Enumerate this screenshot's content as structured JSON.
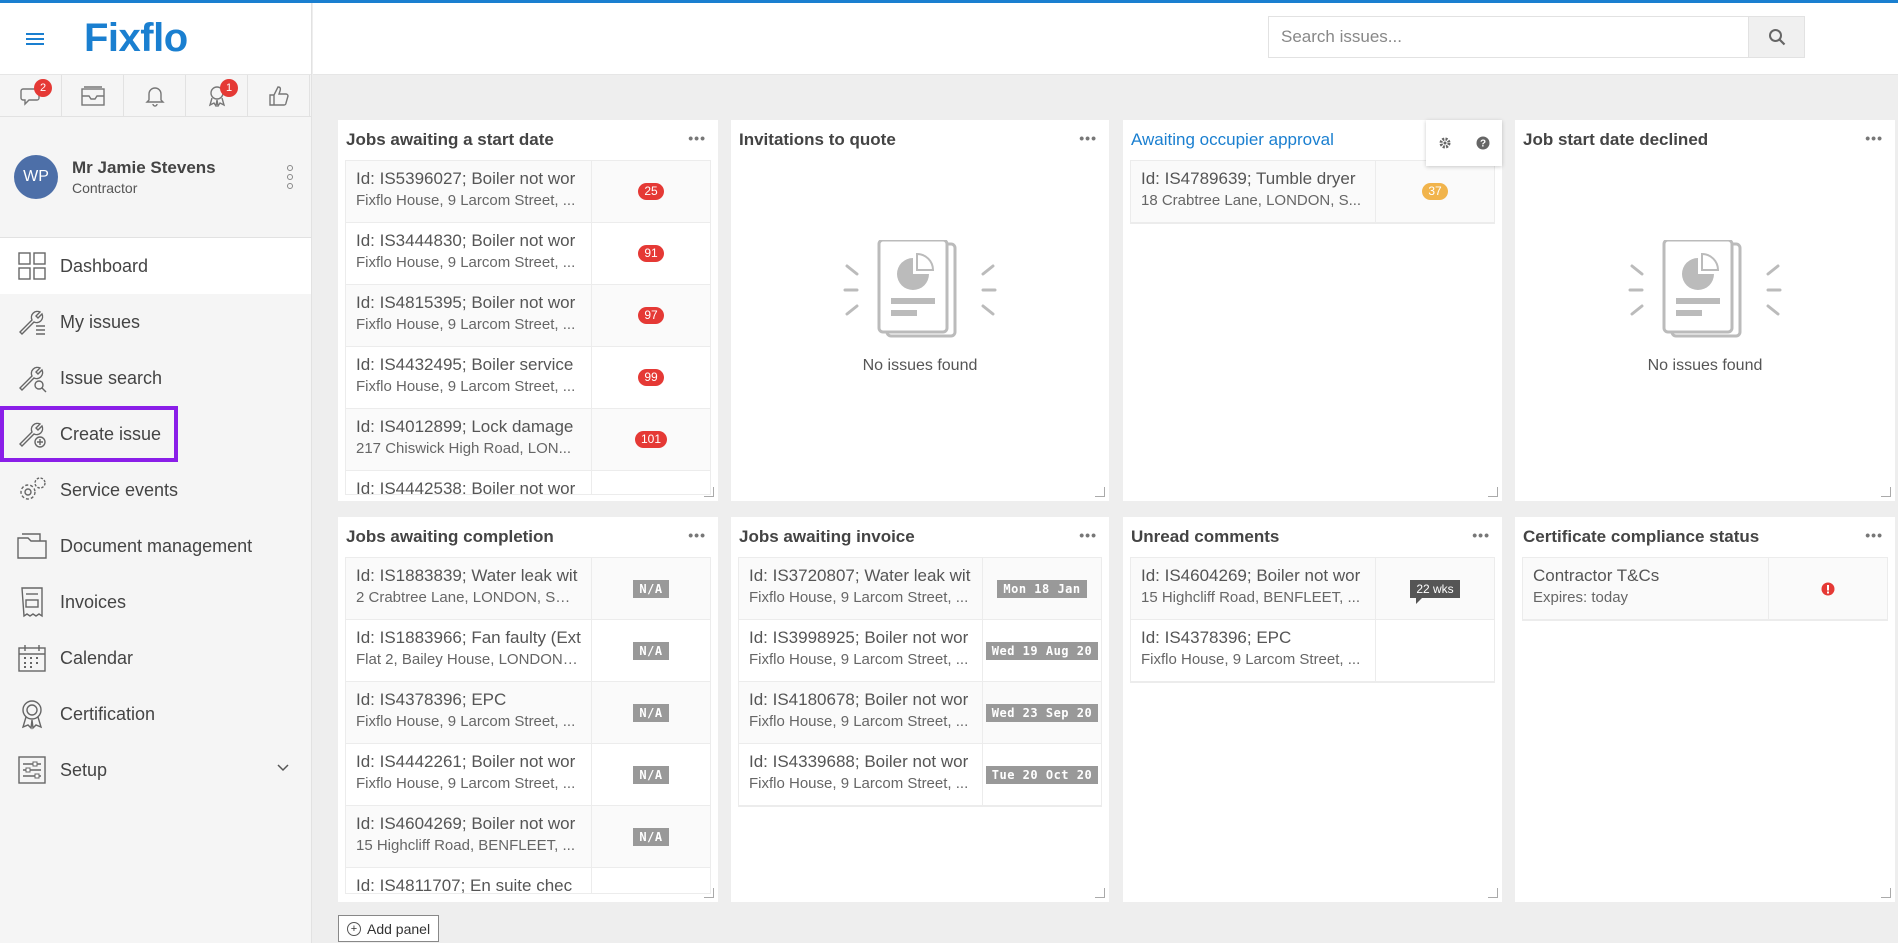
{
  "app": {
    "logo": "Fixflo"
  },
  "quick": [
    {
      "icon": "chat-icon",
      "badge": "2"
    },
    {
      "icon": "inbox-icon",
      "badge": ""
    },
    {
      "icon": "bell-icon",
      "badge": ""
    },
    {
      "icon": "award-icon",
      "badge": "1"
    },
    {
      "icon": "thumbs-up-icon",
      "badge": ""
    }
  ],
  "user": {
    "initials": "WP",
    "name": "Mr Jamie Stevens",
    "role": "Contractor"
  },
  "nav": [
    {
      "label": "Dashboard",
      "icon": "dashboard-icon"
    },
    {
      "label": "My issues",
      "icon": "wrench-list-icon"
    },
    {
      "label": "Issue search",
      "icon": "wrench-search-icon"
    },
    {
      "label": "Create issue",
      "icon": "wrench-plus-icon"
    },
    {
      "label": "Service events",
      "icon": "gears-icon"
    },
    {
      "label": "Document management",
      "icon": "folder-icon"
    },
    {
      "label": "Invoices",
      "icon": "invoice-icon"
    },
    {
      "label": "Calendar",
      "icon": "calendar-icon"
    },
    {
      "label": "Certification",
      "icon": "certificate-icon"
    },
    {
      "label": "Setup",
      "icon": "sliders-icon"
    }
  ],
  "search": {
    "placeholder": "Search issues..."
  },
  "panels": {
    "start": {
      "title": "Jobs awaiting a start date",
      "rows": [
        {
          "id": "Id: IS5396027; Boiler not wor",
          "addr": "Fixflo House, 9 Larcom Street, ...",
          "val": "25"
        },
        {
          "id": "Id: IS3444830; Boiler not wor",
          "addr": "Fixflo House, 9 Larcom Street, ...",
          "val": "91"
        },
        {
          "id": "Id: IS4815395; Boiler not wor",
          "addr": "Fixflo House, 9 Larcom Street, ...",
          "val": "97"
        },
        {
          "id": "Id: IS4432495; Boiler service",
          "addr": "Fixflo House, 9 Larcom Street, ...",
          "val": "99"
        },
        {
          "id": "Id: IS4012899; Lock damage",
          "addr": "217 Chiswick High Road, LON...",
          "val": "101"
        },
        {
          "id": "Id: IS4442538; Boiler not wor",
          "addr": "",
          "val": ""
        }
      ]
    },
    "quote": {
      "title": "Invitations to quote",
      "empty": "No issues found"
    },
    "occupier": {
      "title": "Awaiting occupier approval",
      "rows": [
        {
          "id": "Id: IS4789639; Tumble dryer",
          "addr": "18 Crabtree Lane, LONDON, S...",
          "val": "37"
        }
      ]
    },
    "declined": {
      "title": "Job start date declined",
      "empty": "No issues found"
    },
    "completion": {
      "title": "Jobs awaiting completion",
      "rows": [
        {
          "id": "Id: IS1883839; Water leak wit",
          "addr": "2 Crabtree Lane, LONDON, SW...",
          "val": "N/A"
        },
        {
          "id": "Id: IS1883966; Fan faulty (Ext",
          "addr": "Flat 2, Bailey House, LONDON, ...",
          "val": "N/A"
        },
        {
          "id": "Id: IS4378396; EPC",
          "addr": "Fixflo House, 9 Larcom Street, ...",
          "val": "N/A"
        },
        {
          "id": "Id: IS4442261; Boiler not wor",
          "addr": "Fixflo House, 9 Larcom Street, ...",
          "val": "N/A"
        },
        {
          "id": "Id: IS4604269; Boiler not wor",
          "addr": "15 Highcliff Road, BENFLEET, ...",
          "val": "N/A"
        },
        {
          "id": "Id: IS4811707; En suite chec",
          "addr": "",
          "val": ""
        }
      ]
    },
    "invoice": {
      "title": "Jobs awaiting invoice",
      "rows": [
        {
          "id": "Id: IS3720807; Water leak wit",
          "addr": "Fixflo House, 9 Larcom Street, ...",
          "val": "Mon 18 Jan"
        },
        {
          "id": "Id: IS3998925; Boiler not wor",
          "addr": "Fixflo House, 9 Larcom Street, ...",
          "val": "Wed 19 Aug 20"
        },
        {
          "id": "Id: IS4180678; Boiler not wor",
          "addr": "Fixflo House, 9 Larcom Street, ...",
          "val": "Wed 23 Sep 20"
        },
        {
          "id": "Id: IS4339688; Boiler not wor",
          "addr": "Fixflo House, 9 Larcom Street, ...",
          "val": "Tue 20 Oct 20"
        }
      ]
    },
    "comments": {
      "title": "Unread comments",
      "rows": [
        {
          "id": "Id: IS4604269; Boiler not wor",
          "addr": "15 Highcliff Road, BENFLEET, ...",
          "val": "22 wks"
        },
        {
          "id": "Id: IS4378396; EPC",
          "addr": "Fixflo House, 9 Larcom Street, ...",
          "val": ""
        }
      ]
    },
    "cert": {
      "title": "Certificate compliance status",
      "rows": [
        {
          "id": "Contractor T&Cs",
          "addr": "Expires: today",
          "val": ""
        }
      ]
    }
  },
  "add_panel": "Add panel"
}
